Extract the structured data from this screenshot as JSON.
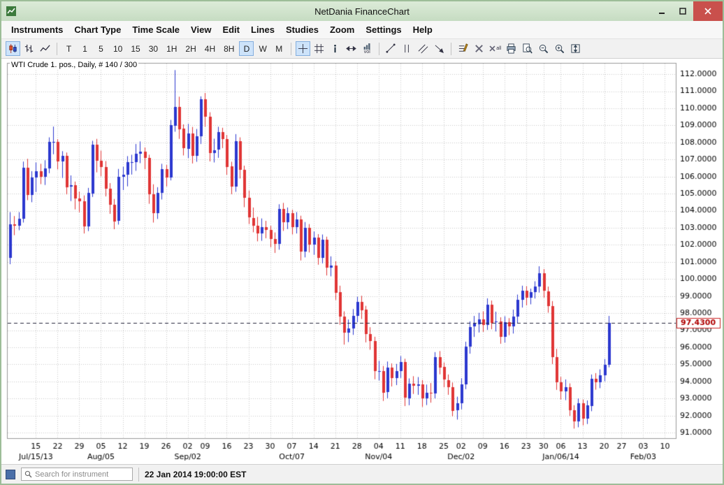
{
  "window": {
    "title": "NetDania FinanceChart"
  },
  "menu": {
    "items": [
      "Instruments",
      "Chart Type",
      "Time Scale",
      "View",
      "Edit",
      "Lines",
      "Studies",
      "Zoom",
      "Settings",
      "Help"
    ]
  },
  "toolbar": {
    "chart_type_buttons": [
      {
        "name": "candlestick-chart",
        "active": true
      },
      {
        "name": "ohlc-bar-chart",
        "active": false
      },
      {
        "name": "line-chart",
        "active": false
      }
    ],
    "timeframes": [
      "T",
      "1",
      "5",
      "10",
      "15",
      "30",
      "1H",
      "2H",
      "4H",
      "8H",
      "D",
      "W",
      "M"
    ],
    "active_timeframe": "D",
    "vol_label": "vol",
    "delete_all_label": "all",
    "view_tools": [
      {
        "name": "crosshair",
        "active": true
      },
      {
        "name": "grid",
        "active": false
      },
      {
        "name": "info",
        "active": false
      },
      {
        "name": "expand-horizontal",
        "active": false
      },
      {
        "name": "volume",
        "active": false
      }
    ],
    "draw_tools": [
      "trend-line",
      "vertical-lines",
      "trend-channel",
      "arrow-ray"
    ],
    "action_tools": [
      "line-properties",
      "delete",
      "delete-all",
      "print",
      "print-preview",
      "zoom-out",
      "zoom-in",
      "zoom-y-axis"
    ]
  },
  "chart": {
    "instrument_label": "WTI Crude 1. pos., Daily, # 140 / 300",
    "last_price_label": "97.4300"
  },
  "statusbar": {
    "search_placeholder": "Search for instrument",
    "timestamp": "22 Jan 2014 19:00:00 EST"
  },
  "chart_data": {
    "type": "candlestick",
    "title": "WTI Crude 1. pos., Daily",
    "ylim": [
      90.68,
      112.62
    ],
    "y_ticks": [
      "112.0000",
      "111.0000",
      "110.0000",
      "109.0000",
      "108.0000",
      "107.0000",
      "106.0000",
      "105.0000",
      "104.0000",
      "103.0000",
      "102.0000",
      "101.0000",
      "100.0000",
      "99.0000",
      "98.0000",
      "97.0000",
      "96.0000",
      "95.0000",
      "94.0000",
      "93.0000",
      "92.0000",
      "91.0000"
    ],
    "x_ticks": [
      {
        "pos": 6,
        "label": "15"
      },
      {
        "pos": 11,
        "label": "22"
      },
      {
        "pos": 16,
        "label": "29"
      },
      {
        "pos": 21,
        "label": "05"
      },
      {
        "pos": 26,
        "label": "12"
      },
      {
        "pos": 31,
        "label": "19"
      },
      {
        "pos": 36,
        "label": "26"
      },
      {
        "pos": 41,
        "label": "02"
      },
      {
        "pos": 45,
        "label": "09"
      },
      {
        "pos": 50,
        "label": "16"
      },
      {
        "pos": 55,
        "label": "23"
      },
      {
        "pos": 60,
        "label": "30"
      },
      {
        "pos": 65,
        "label": "07"
      },
      {
        "pos": 70,
        "label": "14"
      },
      {
        "pos": 75,
        "label": "21"
      },
      {
        "pos": 80,
        "label": "28"
      },
      {
        "pos": 85,
        "label": "04"
      },
      {
        "pos": 90,
        "label": "11"
      },
      {
        "pos": 95,
        "label": "18"
      },
      {
        "pos": 100,
        "label": "25"
      },
      {
        "pos": 104,
        "label": "02"
      },
      {
        "pos": 109,
        "label": "09"
      },
      {
        "pos": 114,
        "label": "16"
      },
      {
        "pos": 119,
        "label": "23"
      },
      {
        "pos": 123,
        "label": "30"
      },
      {
        "pos": 127,
        "label": "06"
      },
      {
        "pos": 132,
        "label": "13"
      },
      {
        "pos": 137,
        "label": "20"
      },
      {
        "pos": 141,
        "label": "27"
      },
      {
        "pos": 146,
        "label": "03"
      },
      {
        "pos": 151,
        "label": "10"
      }
    ],
    "month_ticks": [
      {
        "pos": 6,
        "label": "Jul/15/13"
      },
      {
        "pos": 21,
        "label": "Aug/05"
      },
      {
        "pos": 41,
        "label": "Sep/02"
      },
      {
        "pos": 65,
        "label": "Oct/07"
      },
      {
        "pos": 85,
        "label": "Nov/04"
      },
      {
        "pos": 104,
        "label": "Dec/02"
      },
      {
        "pos": 127,
        "label": "Jan/06/14"
      },
      {
        "pos": 146,
        "label": "Feb/03"
      }
    ],
    "total_slots": 154,
    "last_price": 97.43,
    "colors": {
      "up": "#2b38cf",
      "down": "#e03535",
      "grid": "#c9c9c9",
      "last_price_line": "#23233c",
      "marker_border": "#cc2222",
      "marker_text": "#b00000"
    },
    "candles": [
      [
        101.24,
        103.92,
        100.87,
        103.22
      ],
      [
        103.22,
        103.69,
        102.57,
        103.14
      ],
      [
        103.14,
        103.92,
        102.86,
        103.53
      ],
      [
        103.53,
        106.88,
        103.31,
        106.52
      ],
      [
        106.52,
        107.04,
        104.62,
        104.91
      ],
      [
        104.91,
        106.32,
        104.5,
        105.95
      ],
      [
        105.95,
        106.83,
        105.1,
        106.32
      ],
      [
        106.32,
        106.75,
        105.56,
        106.0
      ],
      [
        106.0,
        106.96,
        105.51,
        106.48
      ],
      [
        106.48,
        108.3,
        106.2,
        108.04
      ],
      [
        108.04,
        108.93,
        107.31,
        108.05
      ],
      [
        108.05,
        108.19,
        106.42,
        106.91
      ],
      [
        106.91,
        107.49,
        105.92,
        107.23
      ],
      [
        107.23,
        107.41,
        104.96,
        105.39
      ],
      [
        105.39,
        106.07,
        104.57,
        105.49
      ],
      [
        105.49,
        105.71,
        104.08,
        104.7
      ],
      [
        104.7,
        105.12,
        103.91,
        104.55
      ],
      [
        104.55,
        104.9,
        102.67,
        103.08
      ],
      [
        103.08,
        105.34,
        102.81,
        105.03
      ],
      [
        105.03,
        108.1,
        104.81,
        107.89
      ],
      [
        107.89,
        108.21,
        106.25,
        106.94
      ],
      [
        106.94,
        107.52,
        106.02,
        106.56
      ],
      [
        106.56,
        106.91,
        104.84,
        105.3
      ],
      [
        105.3,
        105.62,
        103.82,
        104.37
      ],
      [
        104.37,
        104.69,
        102.92,
        103.4
      ],
      [
        103.4,
        106.45,
        103.19,
        105.97
      ],
      [
        105.97,
        106.58,
        105.21,
        106.11
      ],
      [
        106.11,
        107.2,
        105.43,
        106.83
      ],
      [
        106.83,
        107.28,
        106.12,
        106.85
      ],
      [
        106.85,
        107.91,
        106.34,
        107.33
      ],
      [
        107.33,
        108.06,
        106.79,
        107.46
      ],
      [
        107.46,
        107.71,
        106.43,
        107.1
      ],
      [
        107.1,
        107.28,
        104.41,
        104.96
      ],
      [
        104.96,
        105.55,
        103.31,
        103.85
      ],
      [
        103.85,
        105.38,
        103.52,
        105.03
      ],
      [
        105.03,
        106.75,
        104.66,
        106.42
      ],
      [
        106.42,
        106.68,
        105.42,
        105.92
      ],
      [
        105.92,
        109.32,
        105.78,
        109.01
      ],
      [
        109.01,
        112.24,
        108.63,
        110.1
      ],
      [
        110.1,
        110.68,
        108.21,
        108.8
      ],
      [
        108.8,
        109.06,
        107.24,
        107.65
      ],
      [
        107.65,
        109.09,
        107.09,
        108.54
      ],
      [
        108.54,
        108.91,
        106.77,
        107.23
      ],
      [
        107.23,
        108.79,
        106.87,
        108.37
      ],
      [
        108.37,
        110.7,
        107.91,
        110.53
      ],
      [
        110.53,
        110.9,
        108.92,
        109.52
      ],
      [
        109.52,
        109.77,
        106.89,
        107.39
      ],
      [
        107.39,
        108.22,
        106.83,
        107.56
      ],
      [
        107.56,
        108.92,
        107.1,
        108.6
      ],
      [
        108.6,
        108.86,
        107.67,
        108.21
      ],
      [
        108.21,
        108.44,
        106.11,
        106.59
      ],
      [
        106.59,
        106.87,
        104.97,
        105.42
      ],
      [
        105.42,
        108.49,
        105.11,
        108.07
      ],
      [
        108.07,
        108.3,
        105.89,
        106.39
      ],
      [
        106.39,
        106.64,
        104.21,
        104.75
      ],
      [
        104.75,
        105.18,
        103.22,
        103.59
      ],
      [
        103.59,
        104.19,
        102.74,
        103.13
      ],
      [
        103.13,
        103.64,
        102.21,
        102.66
      ],
      [
        102.66,
        103.55,
        102.24,
        103.03
      ],
      [
        103.03,
        103.41,
        102.39,
        102.87
      ],
      [
        102.87,
        103.12,
        101.86,
        102.33
      ],
      [
        102.33,
        102.73,
        101.53,
        102.04
      ],
      [
        102.04,
        104.38,
        101.72,
        104.1
      ],
      [
        104.1,
        104.46,
        102.82,
        103.31
      ],
      [
        103.31,
        104.19,
        102.93,
        103.84
      ],
      [
        103.84,
        104.06,
        102.61,
        103.03
      ],
      [
        103.03,
        103.92,
        102.67,
        103.49
      ],
      [
        103.49,
        103.71,
        101.09,
        101.61
      ],
      [
        101.61,
        103.34,
        101.27,
        103.01
      ],
      [
        103.01,
        103.22,
        101.56,
        102.02
      ],
      [
        102.02,
        102.79,
        101.42,
        102.41
      ],
      [
        102.41,
        102.63,
        100.84,
        101.21
      ],
      [
        101.21,
        102.61,
        100.92,
        102.29
      ],
      [
        102.29,
        102.48,
        100.21,
        100.67
      ],
      [
        100.67,
        101.33,
        100.16,
        100.81
      ],
      [
        100.81,
        101.04,
        98.77,
        99.22
      ],
      [
        99.22,
        99.61,
        97.32,
        97.8
      ],
      [
        97.8,
        98.11,
        96.16,
        96.86
      ],
      [
        96.86,
        97.63,
        96.31,
        97.11
      ],
      [
        97.11,
        98.24,
        96.73,
        97.85
      ],
      [
        97.85,
        98.96,
        97.47,
        98.68
      ],
      [
        98.68,
        99.02,
        97.66,
        98.2
      ],
      [
        98.2,
        98.43,
        96.29,
        96.77
      ],
      [
        96.77,
        97.18,
        95.86,
        96.38
      ],
      [
        96.38,
        96.62,
        94.13,
        94.61
      ],
      [
        94.61,
        95.21,
        94.06,
        94.62
      ],
      [
        94.62,
        94.91,
        92.86,
        93.37
      ],
      [
        93.37,
        95.17,
        93.02,
        94.8
      ],
      [
        94.8,
        95.06,
        93.71,
        94.2
      ],
      [
        94.2,
        95.03,
        93.79,
        94.6
      ],
      [
        94.6,
        95.49,
        94.21,
        95.14
      ],
      [
        95.14,
        95.33,
        92.56,
        93.04
      ],
      [
        93.04,
        94.18,
        92.61,
        93.88
      ],
      [
        93.88,
        94.31,
        93.27,
        93.76
      ],
      [
        93.76,
        94.26,
        93.22,
        93.84
      ],
      [
        93.84,
        94.09,
        92.51,
        93.03
      ],
      [
        93.03,
        93.82,
        92.62,
        93.34
      ],
      [
        93.34,
        93.91,
        92.76,
        93.33
      ],
      [
        93.33,
        95.72,
        93.01,
        95.44
      ],
      [
        95.44,
        95.78,
        94.42,
        94.84
      ],
      [
        94.84,
        95.11,
        93.66,
        94.09
      ],
      [
        94.09,
        94.41,
        93.22,
        93.68
      ],
      [
        93.68,
        93.94,
        91.96,
        92.3
      ],
      [
        92.3,
        93.11,
        91.77,
        92.72
      ],
      [
        92.72,
        94.19,
        92.37,
        93.82
      ],
      [
        93.82,
        96.33,
        93.55,
        96.04
      ],
      [
        96.04,
        97.52,
        95.63,
        97.2
      ],
      [
        97.2,
        97.84,
        96.61,
        97.38
      ],
      [
        97.38,
        98.02,
        96.87,
        97.65
      ],
      [
        97.65,
        98.11,
        96.91,
        97.34
      ],
      [
        97.34,
        98.87,
        97.02,
        98.51
      ],
      [
        98.51,
        98.74,
        97.06,
        97.44
      ],
      [
        97.44,
        98.09,
        96.93,
        97.5
      ],
      [
        97.5,
        97.76,
        96.21,
        96.6
      ],
      [
        96.6,
        97.82,
        96.28,
        97.48
      ],
      [
        97.48,
        97.71,
        96.71,
        97.22
      ],
      [
        97.22,
        98.21,
        96.81,
        97.8
      ],
      [
        97.8,
        99.09,
        97.42,
        98.77
      ],
      [
        98.77,
        99.61,
        98.33,
        99.32
      ],
      [
        99.32,
        99.58,
        98.46,
        98.91
      ],
      [
        98.91,
        99.44,
        98.52,
        99.22
      ],
      [
        99.22,
        99.87,
        98.86,
        99.55
      ],
      [
        99.55,
        100.75,
        99.21,
        100.32
      ],
      [
        100.32,
        100.59,
        98.91,
        99.29
      ],
      [
        99.29,
        99.56,
        98.03,
        98.42
      ],
      [
        98.42,
        98.71,
        95.02,
        95.44
      ],
      [
        95.44,
        95.91,
        93.51,
        93.96
      ],
      [
        93.96,
        94.27,
        92.94,
        93.43
      ],
      [
        93.43,
        94.12,
        92.91,
        93.67
      ],
      [
        93.67,
        93.89,
        91.98,
        92.33
      ],
      [
        92.33,
        92.61,
        91.24,
        91.66
      ],
      [
        91.66,
        93.01,
        91.32,
        92.72
      ],
      [
        92.72,
        92.94,
        91.43,
        91.8
      ],
      [
        91.8,
        92.89,
        91.51,
        92.59
      ],
      [
        92.59,
        94.41,
        92.26,
        94.17
      ],
      [
        94.17,
        94.49,
        93.52,
        93.96
      ],
      [
        93.96,
        94.71,
        93.61,
        94.37
      ],
      [
        94.37,
        95.32,
        94.01,
        94.99
      ],
      [
        94.99,
        97.84,
        94.83,
        97.43
      ]
    ]
  }
}
